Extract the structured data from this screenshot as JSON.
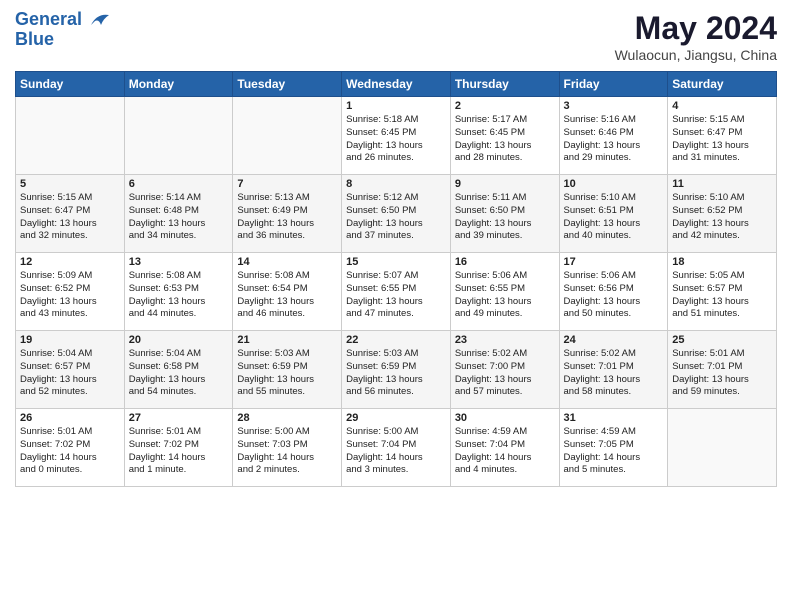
{
  "header": {
    "logo_line1": "General",
    "logo_line2": "Blue",
    "month_year": "May 2024",
    "location": "Wulaocun, Jiangsu, China"
  },
  "weekdays": [
    "Sunday",
    "Monday",
    "Tuesday",
    "Wednesday",
    "Thursday",
    "Friday",
    "Saturday"
  ],
  "weeks": [
    [
      {
        "day": "",
        "text": ""
      },
      {
        "day": "",
        "text": ""
      },
      {
        "day": "",
        "text": ""
      },
      {
        "day": "1",
        "text": "Sunrise: 5:18 AM\nSunset: 6:45 PM\nDaylight: 13 hours\nand 26 minutes."
      },
      {
        "day": "2",
        "text": "Sunrise: 5:17 AM\nSunset: 6:45 PM\nDaylight: 13 hours\nand 28 minutes."
      },
      {
        "day": "3",
        "text": "Sunrise: 5:16 AM\nSunset: 6:46 PM\nDaylight: 13 hours\nand 29 minutes."
      },
      {
        "day": "4",
        "text": "Sunrise: 5:15 AM\nSunset: 6:47 PM\nDaylight: 13 hours\nand 31 minutes."
      }
    ],
    [
      {
        "day": "5",
        "text": "Sunrise: 5:15 AM\nSunset: 6:47 PM\nDaylight: 13 hours\nand 32 minutes."
      },
      {
        "day": "6",
        "text": "Sunrise: 5:14 AM\nSunset: 6:48 PM\nDaylight: 13 hours\nand 34 minutes."
      },
      {
        "day": "7",
        "text": "Sunrise: 5:13 AM\nSunset: 6:49 PM\nDaylight: 13 hours\nand 36 minutes."
      },
      {
        "day": "8",
        "text": "Sunrise: 5:12 AM\nSunset: 6:50 PM\nDaylight: 13 hours\nand 37 minutes."
      },
      {
        "day": "9",
        "text": "Sunrise: 5:11 AM\nSunset: 6:50 PM\nDaylight: 13 hours\nand 39 minutes."
      },
      {
        "day": "10",
        "text": "Sunrise: 5:10 AM\nSunset: 6:51 PM\nDaylight: 13 hours\nand 40 minutes."
      },
      {
        "day": "11",
        "text": "Sunrise: 5:10 AM\nSunset: 6:52 PM\nDaylight: 13 hours\nand 42 minutes."
      }
    ],
    [
      {
        "day": "12",
        "text": "Sunrise: 5:09 AM\nSunset: 6:52 PM\nDaylight: 13 hours\nand 43 minutes."
      },
      {
        "day": "13",
        "text": "Sunrise: 5:08 AM\nSunset: 6:53 PM\nDaylight: 13 hours\nand 44 minutes."
      },
      {
        "day": "14",
        "text": "Sunrise: 5:08 AM\nSunset: 6:54 PM\nDaylight: 13 hours\nand 46 minutes."
      },
      {
        "day": "15",
        "text": "Sunrise: 5:07 AM\nSunset: 6:55 PM\nDaylight: 13 hours\nand 47 minutes."
      },
      {
        "day": "16",
        "text": "Sunrise: 5:06 AM\nSunset: 6:55 PM\nDaylight: 13 hours\nand 49 minutes."
      },
      {
        "day": "17",
        "text": "Sunrise: 5:06 AM\nSunset: 6:56 PM\nDaylight: 13 hours\nand 50 minutes."
      },
      {
        "day": "18",
        "text": "Sunrise: 5:05 AM\nSunset: 6:57 PM\nDaylight: 13 hours\nand 51 minutes."
      }
    ],
    [
      {
        "day": "19",
        "text": "Sunrise: 5:04 AM\nSunset: 6:57 PM\nDaylight: 13 hours\nand 52 minutes."
      },
      {
        "day": "20",
        "text": "Sunrise: 5:04 AM\nSunset: 6:58 PM\nDaylight: 13 hours\nand 54 minutes."
      },
      {
        "day": "21",
        "text": "Sunrise: 5:03 AM\nSunset: 6:59 PM\nDaylight: 13 hours\nand 55 minutes."
      },
      {
        "day": "22",
        "text": "Sunrise: 5:03 AM\nSunset: 6:59 PM\nDaylight: 13 hours\nand 56 minutes."
      },
      {
        "day": "23",
        "text": "Sunrise: 5:02 AM\nSunset: 7:00 PM\nDaylight: 13 hours\nand 57 minutes."
      },
      {
        "day": "24",
        "text": "Sunrise: 5:02 AM\nSunset: 7:01 PM\nDaylight: 13 hours\nand 58 minutes."
      },
      {
        "day": "25",
        "text": "Sunrise: 5:01 AM\nSunset: 7:01 PM\nDaylight: 13 hours\nand 59 minutes."
      }
    ],
    [
      {
        "day": "26",
        "text": "Sunrise: 5:01 AM\nSunset: 7:02 PM\nDaylight: 14 hours\nand 0 minutes."
      },
      {
        "day": "27",
        "text": "Sunrise: 5:01 AM\nSunset: 7:02 PM\nDaylight: 14 hours\nand 1 minute."
      },
      {
        "day": "28",
        "text": "Sunrise: 5:00 AM\nSunset: 7:03 PM\nDaylight: 14 hours\nand 2 minutes."
      },
      {
        "day": "29",
        "text": "Sunrise: 5:00 AM\nSunset: 7:04 PM\nDaylight: 14 hours\nand 3 minutes."
      },
      {
        "day": "30",
        "text": "Sunrise: 4:59 AM\nSunset: 7:04 PM\nDaylight: 14 hours\nand 4 minutes."
      },
      {
        "day": "31",
        "text": "Sunrise: 4:59 AM\nSunset: 7:05 PM\nDaylight: 14 hours\nand 5 minutes."
      },
      {
        "day": "",
        "text": ""
      }
    ]
  ]
}
